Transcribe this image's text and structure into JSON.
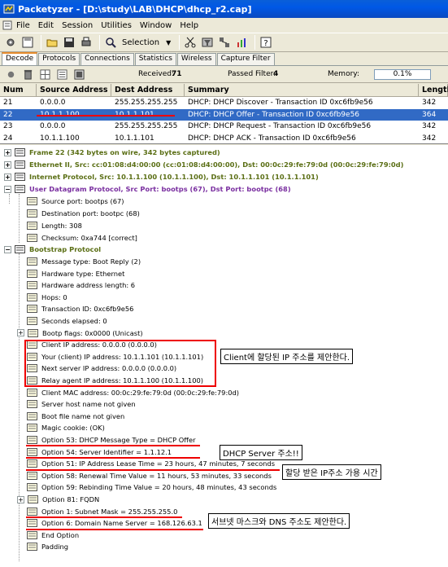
{
  "window": {
    "title": "Packetyzer - [D:\\study\\LAB\\DHCP\\dhcp_r2.cap]"
  },
  "menu": [
    "File",
    "Edit",
    "Session",
    "Utilities",
    "Window",
    "Help"
  ],
  "toolbar": {
    "selection_label": "Selection"
  },
  "tabs": [
    "Decode",
    "Protocols",
    "Connections",
    "Statistics",
    "Wireless",
    "Capture Filter"
  ],
  "status": {
    "received_label": "Received:",
    "received": "71",
    "passed_label": "Passed Filter:",
    "passed": "4",
    "memory_label": "Memory:",
    "memory": "0.1%"
  },
  "packet_table": {
    "headers": [
      "Num",
      "Source Address",
      "Dest Address",
      "Summary",
      "Length"
    ],
    "rows": [
      [
        "21",
        "0.0.0.0",
        "255.255.255.255",
        "DHCP: DHCP Discover - Transaction ID 0xc6fb9e56",
        "342"
      ],
      [
        "22",
        "10.1.1.100",
        "10.1.1.101",
        "DHCP: DHCP Offer  - Transaction ID 0xc6fb9e56",
        "364"
      ],
      [
        "23",
        "0.0.0.0",
        "255.255.255.255",
        "DHCP: DHCP Request - Transaction ID 0xc6fb9e56",
        "342"
      ],
      [
        "24",
        "10.1.1.100",
        "10.1.1.101",
        "DHCP: DHCP ACK   - Transaction ID 0xc6fb9e56",
        "342"
      ]
    ]
  },
  "tree": {
    "headers": [
      "Frame 22 (342 bytes on wire, 342 bytes captured)",
      "Ethernet II, Src: cc:01:08:d4:00:00 (cc:01:08:d4:00:00), Dst: 00:0c:29:fe:79:0d (00:0c:29:fe:79:0d)",
      "Internet Protocol, Src: 10.1.1.100 (10.1.1.100), Dst: 10.1.1.101 (10.1.1.101)",
      "User Datagram Protocol, Src Port: bootps (67), Dst Port: bootpc (68)"
    ],
    "udp_fields": [
      "Source port: bootps (67)",
      "Destination port: bootpc (68)",
      "Length: 308",
      "Checksum: 0xa744 [correct]"
    ],
    "bootp_header": "Bootstrap Protocol",
    "bootp_fields": [
      "Message type: Boot Reply (2)",
      "Hardware type: Ethernet",
      "Hardware address length: 6",
      "Hops: 0",
      "Transaction ID: 0xc6fb9e56",
      "Seconds elapsed: 0",
      "Bootp flags: 0x0000 (Unicast)",
      "Client IP address: 0.0.0.0 (0.0.0.0)",
      "Your (client) IP address: 10.1.1.101 (10.1.1.101)",
      "Next server IP address: 0.0.0.0 (0.0.0.0)",
      "Relay agent IP address: 10.1.1.100 (10.1.1.100)",
      "Client MAC address: 00:0c:29:fe:79:0d (00:0c:29:fe:79:0d)",
      "Server host name not given",
      "Boot file name not given",
      "Magic cookie: (OK)",
      "Option 53: DHCP Message Type = DHCP Offer",
      "Option 54: Server Identifier = 1.1.12.1",
      "Option 51: IP Address Lease Time = 23 hours, 47 minutes, 7 seconds",
      "Option 58: Renewal Time Value = 11 hours, 53 minutes, 33 seconds",
      "Option 59: Rebinding Time Value = 20 hours, 48 minutes, 43 seconds",
      "Option 81: FQDN",
      "Option 1: Subnet Mask = 255.255.255.0",
      "Option 6: Domain Name Server = 168.126.63.1",
      "End Option",
      "Padding"
    ]
  },
  "annotations": {
    "client_ip": "Client에 할당된 IP 주소를 제안한다.",
    "server_addr": "DHCP Server 주소!!",
    "lease": "할당 받은 IP주소 가용 시간",
    "mask_dns": "서브넷 마스크와 DNS 주소도 제안한다."
  },
  "colors": {
    "selected_row": "#316ac5",
    "annotation": "#e00000",
    "title_bar": "#0058e6"
  }
}
